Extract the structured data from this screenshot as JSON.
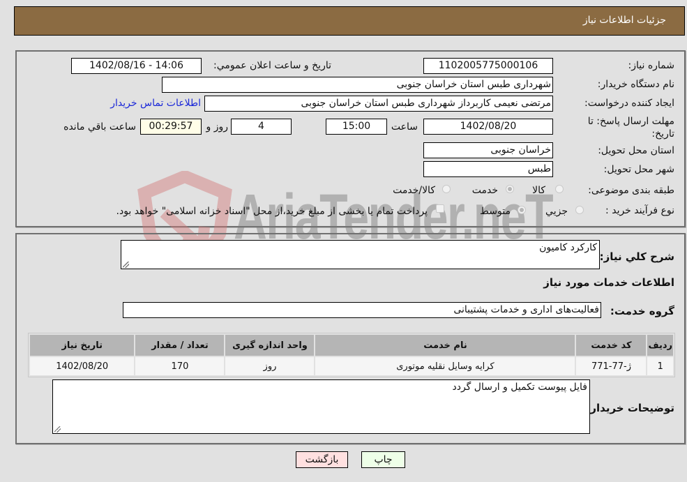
{
  "header": {
    "title": "جزئیات اطلاعات نیاز"
  },
  "form": {
    "need_number_label": "شماره نیاز:",
    "need_number": "1102005775000106",
    "announce_label": "تاریخ و ساعت اعلان عمومي:",
    "announce_value": "1402/08/16 - 14:06",
    "buyer_org_label": "نام دستگاه خریدار:",
    "buyer_org": "شهرداری طبس استان خراسان جنوبی",
    "creator_label": "ایجاد کننده درخواست:",
    "creator": "مرتضی نعیمی کاربرداز شهرداری طبس استان خراسان جنوبی",
    "contact_link": "اطلاعات تماس خریدار",
    "deadline_label": "مهلت ارسال پاسخ: تا تاریخ:",
    "deadline_date": "1402/08/20",
    "time_label": "ساعت",
    "deadline_time": "15:00",
    "days_value": "4",
    "days_label": "روز و",
    "remaining_time": "00:29:57",
    "remaining_label": "ساعت باقي مانده",
    "province_label": "استان محل تحویل:",
    "province": "خراسان جنوبی",
    "city_label": "شهر محل تحویل:",
    "city": "طبس",
    "category_label": "طبقه بندی موضوعی:",
    "category_options": [
      {
        "label": "کالا",
        "checked": false
      },
      {
        "label": "خدمت",
        "checked": true
      },
      {
        "label": "کالا/خدمت",
        "checked": false
      }
    ],
    "process_label": "نوع فرآیند خرید :",
    "process_options": [
      {
        "label": "جزيي",
        "checked": false
      },
      {
        "label": "متوسط",
        "checked": true
      }
    ],
    "treasury_checkbox_label": "پرداخت تمام یا بخشی از مبلغ خرید،از محل \"اسناد خزانه اسلامی\" خواهد بود."
  },
  "details": {
    "summary_label": "شرح کلي نياز:",
    "summary": "کارکرد کامیون",
    "services_heading": "اطلاعات خدمات مورد نیاز",
    "service_group_label": "گروه خدمت:",
    "service_group": "فعالیت‌های اداری و خدمات پشتیبانی",
    "table": {
      "headers": [
        "ردیف",
        "کد خدمت",
        "نام خدمت",
        "واحد اندازه گیری",
        "تعداد / مقدار",
        "تاریخ نیاز"
      ],
      "rows": [
        [
          "1",
          "ژ-77-771",
          "کرایه وسایل نقلیه موتوری",
          "روز",
          "170",
          "1402/08/20"
        ]
      ]
    },
    "buyer_notes_label": "توضیحات خریدار:",
    "buyer_notes": "فایل پیوست تکمیل و ارسال گردد"
  },
  "buttons": {
    "print": "چاپ",
    "back": "بازگشت"
  },
  "watermark": {
    "text": "AriaTender.neT"
  },
  "colors": {
    "header_bg": "#8b6b42",
    "link": "#1a27d8",
    "print_bg": "#eeffe8",
    "back_bg": "#ffe0e0"
  }
}
